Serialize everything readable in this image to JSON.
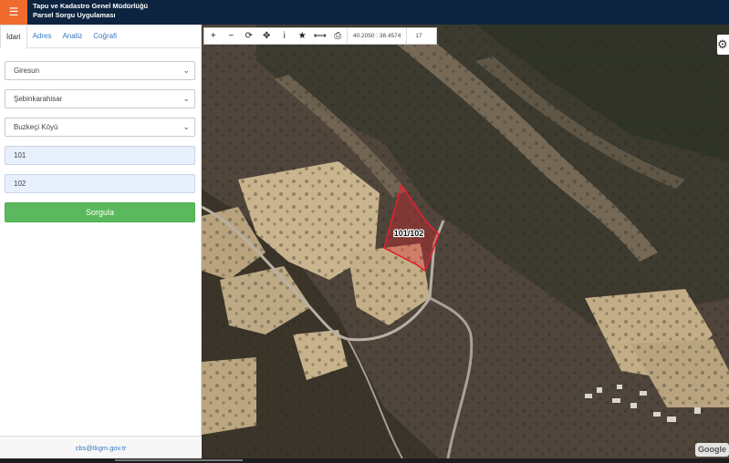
{
  "header": {
    "menu_icon": "☰",
    "title_line1": "Tapu ve Kadastro Genel Müdürlüğü",
    "title_line2": "Parsel Sorgu Uygulaması"
  },
  "tabs": [
    {
      "label": "İdari"
    },
    {
      "label": "Adres"
    },
    {
      "label": "Analiz"
    },
    {
      "label": "Coğrafi"
    }
  ],
  "form": {
    "province": "Giresun",
    "district": "Şebinkarahisar",
    "neighborhood": "Buzkeçi Köyü",
    "block": "101",
    "parcel": "102",
    "query_label": "Sorgula"
  },
  "footer": {
    "email": "cbs@tkgm.gov.tr"
  },
  "toolbar": {
    "icons": [
      "+",
      "−",
      "⟳",
      "✥",
      "i",
      "★",
      "⟷",
      "⎙"
    ],
    "coords": "40.2050 : 38.4574",
    "zoom": "17"
  },
  "map": {
    "parcel_label": "101/102",
    "parcel_color": "#e0212f",
    "attribution": "Google"
  },
  "colors": {
    "header_bg": "#0d2440",
    "menu_accent": "#ef6c2e",
    "button_green": "#5cb85c",
    "link_blue": "#3a78c3"
  }
}
